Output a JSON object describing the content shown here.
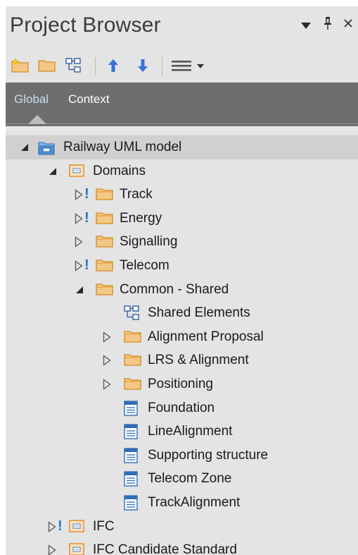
{
  "window": {
    "title": "Project Browser",
    "controls": {
      "menu": "▼",
      "pin": "ꟷ",
      "close": "×"
    }
  },
  "toolbar": {
    "buttons": [
      {
        "name": "new-model-button",
        "icon": "folder-star-icon"
      },
      {
        "name": "new-package-button",
        "icon": "folder-icon"
      },
      {
        "name": "new-diagram-button",
        "icon": "diagram-icon"
      },
      {
        "name": "move-up-button",
        "icon": "arrow-up-icon"
      },
      {
        "name": "move-down-button",
        "icon": "arrow-down-icon"
      },
      {
        "name": "menu-button",
        "icon": "hamburger-dropdown-icon"
      }
    ]
  },
  "tabs": [
    {
      "label": "Global",
      "active": true
    },
    {
      "label": "Context",
      "active": false
    }
  ],
  "tree": [
    {
      "label": "Railway UML model",
      "level": 0,
      "expander": "◢",
      "icon": "root-model-icon",
      "selected": true
    },
    {
      "label": "Domains",
      "level": 1,
      "expander": "◢",
      "icon": "package-icon"
    },
    {
      "label": "Track",
      "level": 2,
      "expander": "▷",
      "excl": true,
      "icon": "folder-icon"
    },
    {
      "label": "Energy",
      "level": 2,
      "expander": "▷",
      "excl": true,
      "icon": "folder-icon"
    },
    {
      "label": "Signalling",
      "level": 2,
      "expander": "▷",
      "icon": "folder-icon"
    },
    {
      "label": "Telecom",
      "level": 2,
      "expander": "▷",
      "excl": true,
      "icon": "folder-icon"
    },
    {
      "label": "Common - Shared",
      "level": 2,
      "expander": "◢",
      "icon": "folder-icon"
    },
    {
      "label": "Shared Elements",
      "level": 3,
      "icon": "diagram-icon"
    },
    {
      "label": "Alignment Proposal",
      "level": 3,
      "expander": "▷",
      "icon": "folder-icon"
    },
    {
      "label": "LRS & Alignment",
      "level": 3,
      "expander": "▷",
      "icon": "folder-icon"
    },
    {
      "label": "Positioning",
      "level": 3,
      "expander": "▷",
      "icon": "folder-icon"
    },
    {
      "label": "Foundation",
      "level": 3,
      "icon": "class-icon"
    },
    {
      "label": "LineAlignment",
      "level": 3,
      "icon": "class-icon"
    },
    {
      "label": "Supporting structure",
      "level": 3,
      "icon": "class-icon"
    },
    {
      "label": "Telecom Zone",
      "level": 3,
      "icon": "class-icon"
    },
    {
      "label": "TrackAlignment",
      "level": 3,
      "icon": "class-icon"
    },
    {
      "label": "IFC",
      "level": 1,
      "expander": "▷",
      "excl": true,
      "icon": "package-icon"
    },
    {
      "label": "IFC Candidate Standard",
      "level": 1,
      "expander": "▷",
      "icon": "package-icon"
    }
  ],
  "colors": {
    "folder": "#f3c886",
    "folder_outline": "#d48a1e",
    "package_fill": "#fbe3c2",
    "package_outline": "#e08a1e",
    "class_blue": "#2f6fb3",
    "exclamation": "#1976d2",
    "arrow": "#3a6fd8"
  }
}
